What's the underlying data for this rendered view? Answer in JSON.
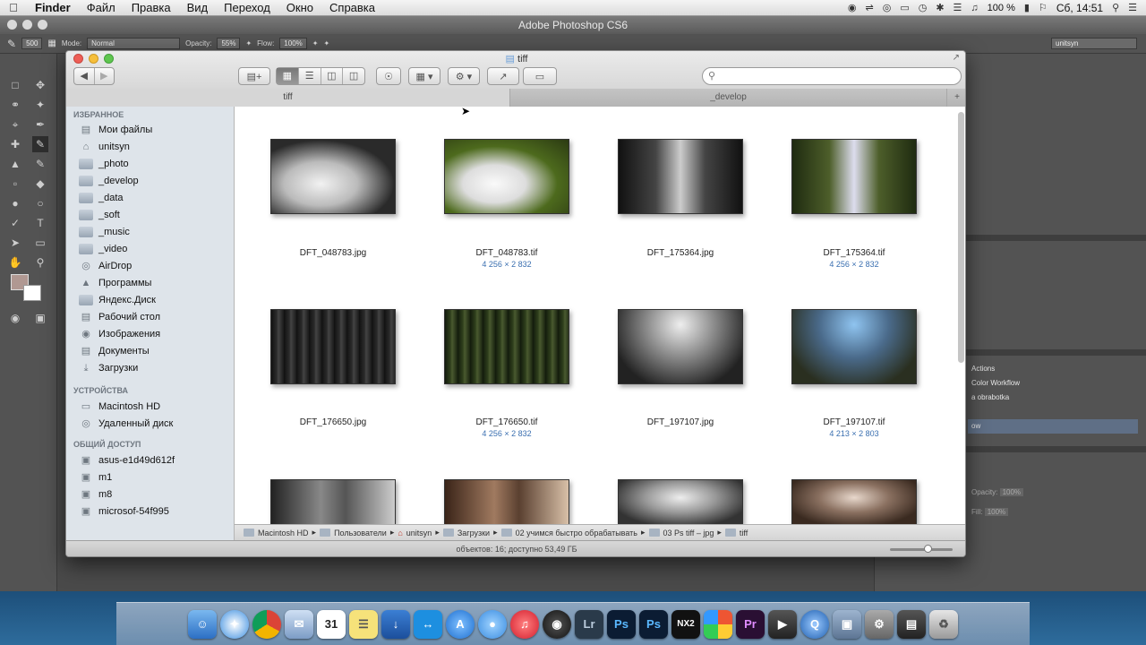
{
  "menubar": {
    "apple_icon": "apple-logo",
    "items": [
      "Finder",
      "Файл",
      "Правка",
      "Вид",
      "Переход",
      "Окно",
      "Справка"
    ],
    "battery": "100 %",
    "clock": "Сб, 14:51"
  },
  "photoshop": {
    "title": "Adobe Photoshop CS6",
    "brush_size": "500",
    "mode_label": "Mode:",
    "mode_value": "Normal",
    "opacity_label": "Opacity:",
    "opacity_value": "55%",
    "flow_label": "Flow:",
    "flow_value": "100%",
    "workspace": "unitsyn",
    "panel": {
      "actions_items": [
        "Actions",
        "Color Workflow",
        "a obrabotka",
        "ow"
      ],
      "opacity_label": "Opacity:",
      "opacity_value": "100%",
      "fill_label": "Fill:",
      "fill_value": "100%"
    }
  },
  "finder": {
    "window_title": "tiff",
    "search_placeholder": "",
    "tabs": [
      "tiff",
      "_develop"
    ],
    "sidebar": {
      "favorites_header": "ИЗБРАННОЕ",
      "favorites": [
        {
          "label": "Мои файлы",
          "icon": "all-files-icon"
        },
        {
          "label": "unitsyn",
          "icon": "home-icon"
        },
        {
          "label": "_photo",
          "icon": "folder-icon"
        },
        {
          "label": "_develop",
          "icon": "folder-icon"
        },
        {
          "label": "_data",
          "icon": "folder-icon"
        },
        {
          "label": "_soft",
          "icon": "folder-icon"
        },
        {
          "label": "_music",
          "icon": "folder-icon"
        },
        {
          "label": "_video",
          "icon": "folder-icon"
        },
        {
          "label": "AirDrop",
          "icon": "airdrop-icon"
        },
        {
          "label": "Программы",
          "icon": "applications-icon"
        },
        {
          "label": "Яндекс.Диск",
          "icon": "folder-icon"
        },
        {
          "label": "Рабочий стол",
          "icon": "desktop-icon"
        },
        {
          "label": "Изображения",
          "icon": "camera-icon"
        },
        {
          "label": "Документы",
          "icon": "documents-icon"
        },
        {
          "label": "Загрузки",
          "icon": "downloads-icon"
        }
      ],
      "devices_header": "УСТРОЙСТВА",
      "devices": [
        {
          "label": "Macintosh HD",
          "icon": "harddrive-icon"
        },
        {
          "label": "Удаленный диск",
          "icon": "disc-icon"
        }
      ],
      "shared_header": "ОБЩИЙ ДОСТУП",
      "shared": [
        {
          "label": "asus-e1d49d612f",
          "icon": "computer-icon"
        },
        {
          "label": "m1",
          "icon": "computer-icon"
        },
        {
          "label": "m8",
          "icon": "computer-icon"
        },
        {
          "label": "microsof-54f995",
          "icon": "computer-icon"
        }
      ]
    },
    "files": [
      {
        "name": "DFT_048783.jpg",
        "dims": ""
      },
      {
        "name": "DFT_048783.tif",
        "dims": "4 256 × 2 832"
      },
      {
        "name": "DFT_175364.jpg",
        "dims": ""
      },
      {
        "name": "DFT_175364.tif",
        "dims": "4 256 × 2 832"
      },
      {
        "name": "DFT_176650.jpg",
        "dims": ""
      },
      {
        "name": "DFT_176650.tif",
        "dims": "4 256 × 2 832"
      },
      {
        "name": "DFT_197107.jpg",
        "dims": ""
      },
      {
        "name": "DFT_197107.tif",
        "dims": "4 213 × 2 803"
      }
    ],
    "path": [
      "Macintosh HD",
      "Пользователи",
      "unitsyn",
      "Загрузки",
      "02 учимся быстро обрабатывать",
      "03 Ps tiff – jpg",
      "tiff"
    ],
    "status": "объектов: 16; доступно 53,49 ГБ"
  },
  "dock": {
    "items": [
      "finder-icon",
      "safari-icon",
      "chrome-icon",
      "mail-icon",
      "calendar-icon",
      "notes-icon",
      "preview-icon",
      "teamviewer-icon",
      "appstore-icon",
      "messages-icon",
      "itunes-icon",
      "camera-raw-icon",
      "lightroom-icon",
      "photoshop-icon",
      "photoshop-cs6-icon",
      "nikon-nx2-icon",
      "colorchecker-icon",
      "premiere-icon",
      "finalcut-icon",
      "quicktime-icon",
      "system-preferences-icon",
      "folder-stack-icon",
      "trash-icon"
    ],
    "labels": {
      "lightroom": "Lr",
      "photoshop": "Ps",
      "photoshop2": "Ps",
      "nx2": "NX2",
      "premiere": "Pr",
      "calendar": "31"
    }
  }
}
